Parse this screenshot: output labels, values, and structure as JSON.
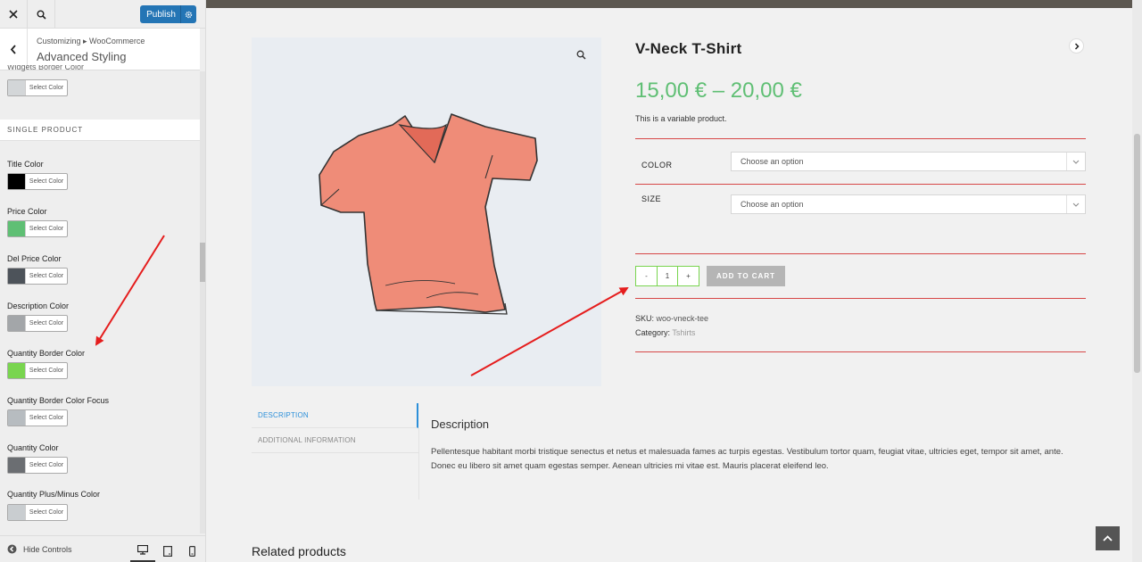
{
  "customizer": {
    "publish_label": "Publish",
    "breadcrumb": "Customizing ▸ WooCommerce",
    "section_title": "Advanced Styling",
    "partial_label": "Widgets Border Color",
    "section_header": "SINGLE PRODUCT",
    "select_color_label": "Select Color",
    "controls": [
      {
        "label": "Title Color",
        "color": "#000000"
      },
      {
        "label": "Price Color",
        "color": "#5fbf74"
      },
      {
        "label": "Del Price Color",
        "color": "#4d535a"
      },
      {
        "label": "Description Color",
        "color": "#a3a6a9"
      },
      {
        "label": "Quantity Border Color",
        "color": "#79d54f"
      },
      {
        "label": "Quantity Border Color Focus",
        "color": "#b7bcc0"
      },
      {
        "label": "Quantity Color",
        "color": "#6b6e72"
      },
      {
        "label": "Quantity Plus/Minus Color",
        "color": "#c9cdd0"
      }
    ],
    "first_swatch_color": "#d3d6d8",
    "hide_controls": "Hide Controls"
  },
  "product": {
    "title": "V-Neck T-Shirt",
    "price": "15,00 € – 20,00 €",
    "short_description": "This is a variable product.",
    "variations": [
      {
        "label": "COLOR",
        "placeholder": "Choose an option"
      },
      {
        "label": "SIZE",
        "placeholder": "Choose an option"
      }
    ],
    "qty_minus": "-",
    "qty_value": "1",
    "qty_plus": "+",
    "add_to_cart": "ADD TO CART",
    "sku_label": "SKU:",
    "sku": "woo-vneck-tee",
    "category_label": "Category:",
    "category": "Tshirts"
  },
  "tabs": [
    {
      "label": "DESCRIPTION",
      "active": true
    },
    {
      "label": "ADDITIONAL INFORMATION",
      "active": false
    }
  ],
  "description": {
    "heading": "Description",
    "body": "Pellentesque habitant morbi tristique senectus et netus et malesuada fames ac turpis egestas. Vestibulum tortor quam, feugiat vitae, ultricies eget, tempor sit amet, ante. Donec eu libero sit amet quam egestas semper. Aenean ultricies mi vitae est. Mauris placerat eleifend leo."
  },
  "related_heading": "Related products",
  "colors": {
    "accent_blue": "#2475b5",
    "price_green": "#5fbf74",
    "divider_red": "#d74747",
    "qty_border_green": "#79d54f",
    "arrow_red": "#e51d1d"
  },
  "icons": [
    "close-icon",
    "search-icon",
    "gear-icon",
    "chevron-left-icon",
    "zoom-icon",
    "chevron-right-icon",
    "chevron-down-icon",
    "collapse-icon",
    "desktop-icon",
    "tablet-icon",
    "mobile-icon",
    "arrow-up-icon"
  ]
}
